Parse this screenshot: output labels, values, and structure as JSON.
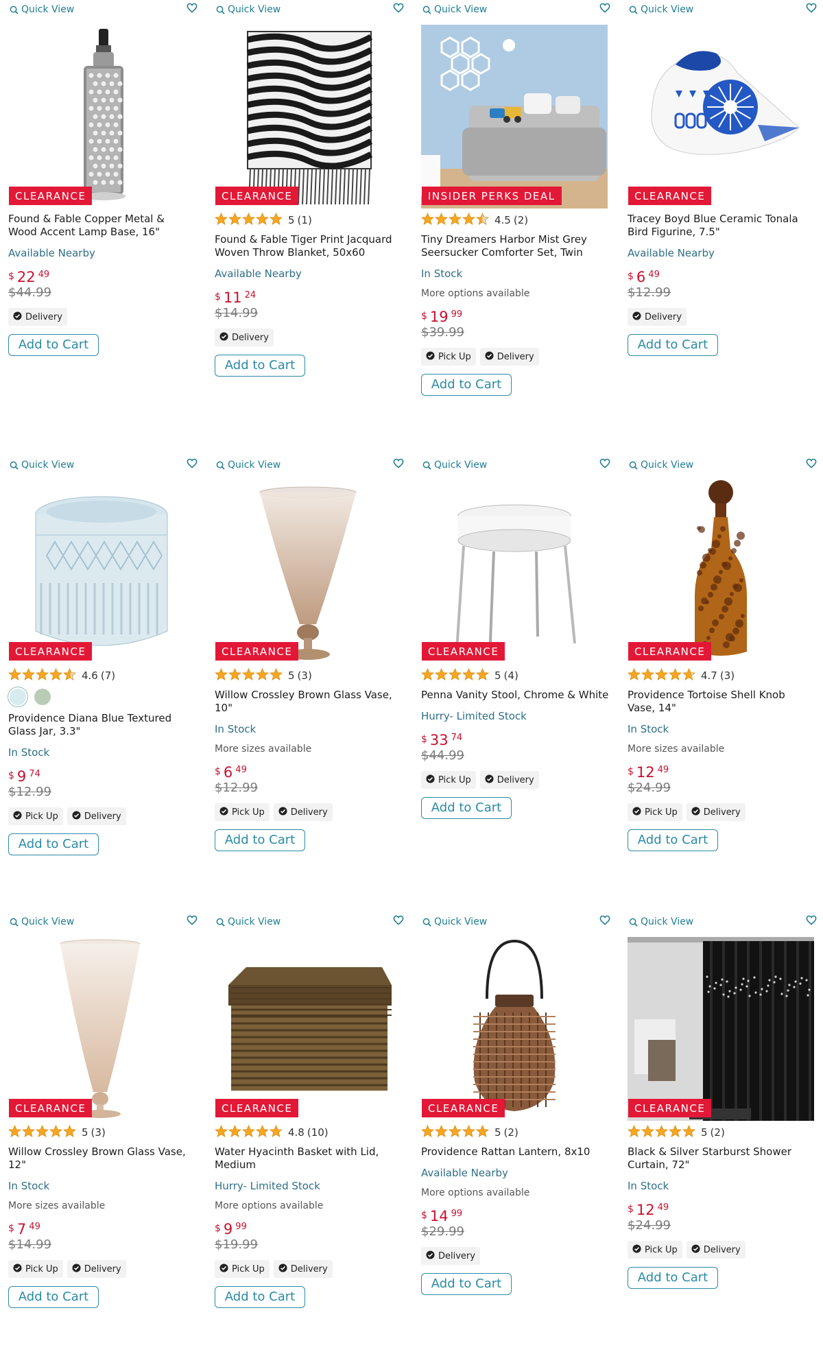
{
  "ui": {
    "quick_view": "Quick View",
    "add_to_cart": "Add to Cart",
    "pick_up": "Pick Up",
    "delivery": "Delivery",
    "badge_clearance": "CLEARANCE",
    "badge_insider": "INSIDER PERKS DEAL"
  },
  "colors": {
    "accent": "#2a8aa6",
    "badge_red": "#e31837",
    "price_red": "#c8102e",
    "star_gold": "#f5a623"
  },
  "products": [
    {
      "title": "Found & Fable Copper Metal & Wood Accent Lamp Base, 16\"",
      "badge": "CLEARANCE",
      "rating_value": "",
      "rating_count": "",
      "availability": "Available Nearby",
      "more": "",
      "price_currency": "$",
      "price_dollars": "22",
      "price_cents": "49",
      "was_price": "$44.99",
      "pickup": false,
      "delivery": true,
      "image": "lamp"
    },
    {
      "title": "Found & Fable Tiger Print Jacquard Woven Throw Blanket, 50x60",
      "badge": "CLEARANCE",
      "rating_value": "5",
      "rating_count": "(1)",
      "availability": "Available Nearby",
      "more": "",
      "price_currency": "$",
      "price_dollars": "11",
      "price_cents": "24",
      "was_price": "$14.99",
      "pickup": false,
      "delivery": true,
      "image": "blanket"
    },
    {
      "title": "Tiny Dreamers Harbor Mist Grey Seersucker Comforter Set, Twin",
      "badge": "INSIDER PERKS DEAL",
      "rating_value": "4.5",
      "rating_count": "(2)",
      "availability": "In Stock",
      "more": "More options available",
      "price_currency": "$",
      "price_dollars": "19",
      "price_cents": "99",
      "was_price": "$39.99",
      "pickup": true,
      "delivery": true,
      "image": "bedroom"
    },
    {
      "title": "Tracey Boyd Blue Ceramic Tonala Bird Figurine, 7.5\"",
      "badge": "CLEARANCE",
      "rating_value": "",
      "rating_count": "",
      "availability": "Available Nearby",
      "more": "",
      "price_currency": "$",
      "price_dollars": "6",
      "price_cents": "49",
      "was_price": "$12.99",
      "pickup": false,
      "delivery": true,
      "image": "bird"
    },
    {
      "title": "Providence Diana Blue Textured Glass Jar, 3.3\"",
      "badge": "CLEARANCE",
      "rating_value": "4.6",
      "rating_count": "(7)",
      "availability": "In Stock",
      "more": "",
      "price_currency": "$",
      "price_dollars": "9",
      "price_cents": "74",
      "was_price": "$12.99",
      "pickup": true,
      "delivery": true,
      "image": "jar",
      "swatches": [
        "#d6ecef",
        "#b9ccb6"
      ]
    },
    {
      "title": "Willow Crossley Brown Glass Vase, 10\"",
      "badge": "CLEARANCE",
      "rating_value": "5",
      "rating_count": "(3)",
      "availability": "In Stock",
      "more": "More sizes available",
      "price_currency": "$",
      "price_dollars": "6",
      "price_cents": "49",
      "was_price": "$12.99",
      "pickup": true,
      "delivery": true,
      "image": "vase_small"
    },
    {
      "title": "Penna Vanity Stool, Chrome & White",
      "badge": "CLEARANCE",
      "rating_value": "5",
      "rating_count": "(4)",
      "availability": "Hurry- Limited Stock",
      "more": "",
      "price_currency": "$",
      "price_dollars": "33",
      "price_cents": "74",
      "was_price": "$44.99",
      "pickup": true,
      "delivery": true,
      "image": "stool"
    },
    {
      "title": "Providence Tortoise Shell Knob Vase, 14\"",
      "badge": "CLEARANCE",
      "rating_value": "4.7",
      "rating_count": "(3)",
      "availability": "In Stock",
      "more": "More sizes available",
      "price_currency": "$",
      "price_dollars": "12",
      "price_cents": "49",
      "was_price": "$24.99",
      "pickup": true,
      "delivery": true,
      "image": "bottle"
    },
    {
      "title": "Willow Crossley Brown Glass Vase, 12\"",
      "badge": "CLEARANCE",
      "rating_value": "5",
      "rating_count": "(3)",
      "availability": "In Stock",
      "more": "More sizes available",
      "price_currency": "$",
      "price_dollars": "7",
      "price_cents": "49",
      "was_price": "$14.99",
      "pickup": true,
      "delivery": true,
      "image": "vase_tall"
    },
    {
      "title": "Water Hyacinth Basket with Lid, Medium",
      "badge": "CLEARANCE",
      "rating_value": "4.8",
      "rating_count": "(10)",
      "availability": "Hurry- Limited Stock",
      "more": "More options available",
      "price_currency": "$",
      "price_dollars": "9",
      "price_cents": "99",
      "was_price": "$19.99",
      "pickup": true,
      "delivery": true,
      "image": "basket"
    },
    {
      "title": "Providence Rattan Lantern, 8x10",
      "badge": "CLEARANCE",
      "rating_value": "5",
      "rating_count": "(2)",
      "availability": "Available Nearby",
      "more": "More options available",
      "price_currency": "$",
      "price_dollars": "14",
      "price_cents": "99",
      "was_price": "$29.99",
      "pickup": false,
      "delivery": true,
      "image": "lantern"
    },
    {
      "title": "Black & Silver Starburst Shower Curtain, 72\"",
      "badge": "CLEARANCE",
      "rating_value": "5",
      "rating_count": "(2)",
      "availability": "In Stock",
      "more": "",
      "price_currency": "$",
      "price_dollars": "12",
      "price_cents": "49",
      "was_price": "$24.99",
      "pickup": true,
      "delivery": true,
      "image": "curtain"
    }
  ]
}
